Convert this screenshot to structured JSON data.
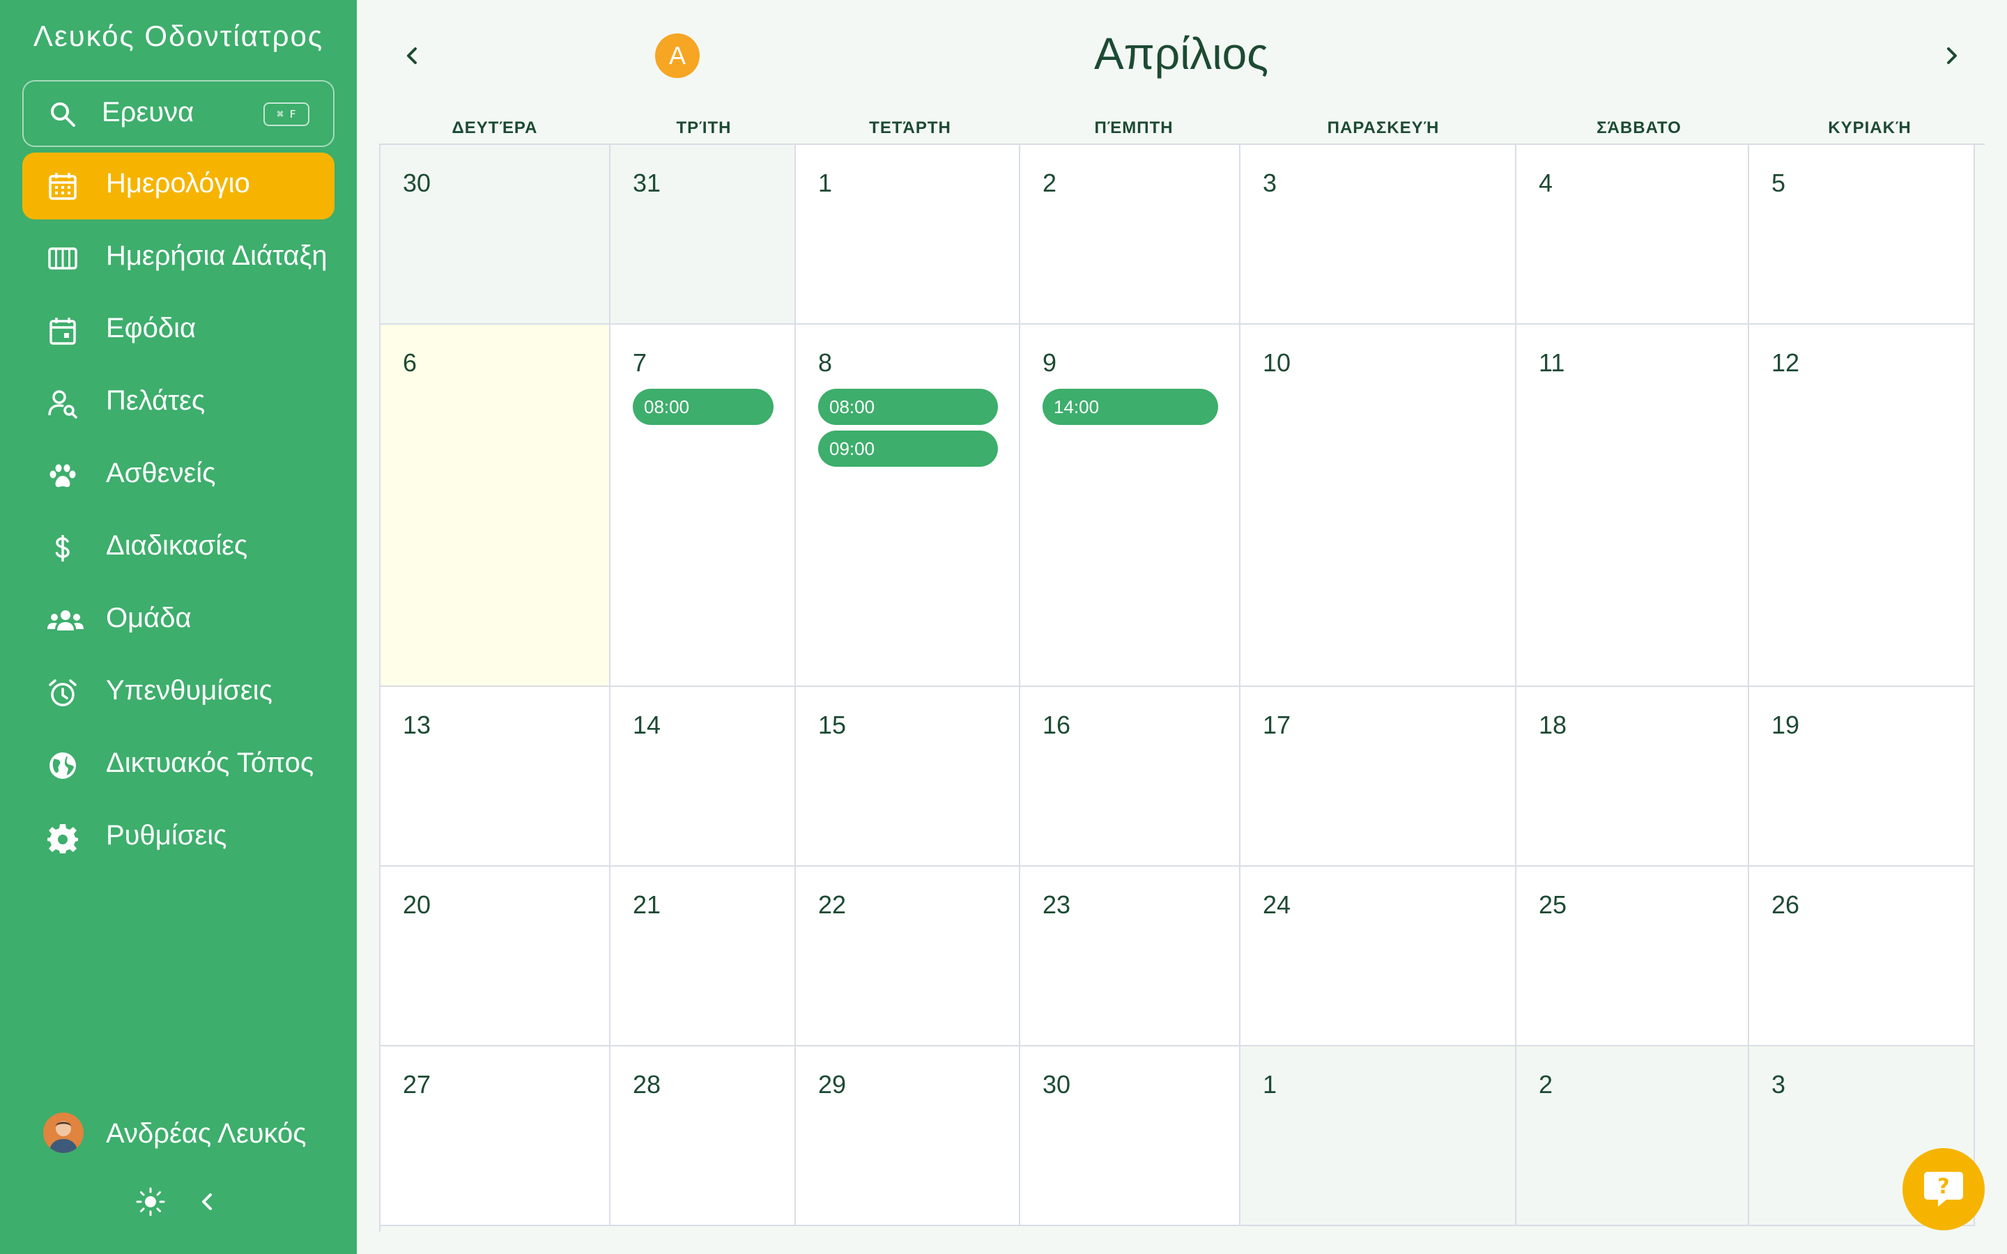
{
  "sidebar": {
    "brand": "Λευκός Οδοντίατρος",
    "search": {
      "label": "Ερευνα",
      "shortcut": "⌘ F"
    },
    "items": [
      {
        "label": "Ημερολόγιο",
        "icon": "calendar-icon",
        "active": true
      },
      {
        "label": "Ημερήσια Διάταξη",
        "icon": "columns-icon",
        "active": false
      },
      {
        "label": "Εφόδια",
        "icon": "calendar-day-icon",
        "active": false
      },
      {
        "label": "Πελάτες",
        "icon": "user-search-icon",
        "active": false
      },
      {
        "label": "Ασθενείς",
        "icon": "paw-icon",
        "active": false
      },
      {
        "label": "Διαδικασίες",
        "icon": "dollar-icon",
        "active": false
      },
      {
        "label": "Ομάδα",
        "icon": "users-icon",
        "active": false
      },
      {
        "label": "Υπενθυμίσεις",
        "icon": "alarm-clock-icon",
        "active": false
      },
      {
        "label": "Δικτυακός Τόπος",
        "icon": "globe-icon",
        "active": false
      },
      {
        "label": "Ρυθμίσεις",
        "icon": "gear-icon",
        "active": false
      }
    ],
    "user": {
      "name": "Ανδρέας Λευκός"
    }
  },
  "header": {
    "month": "Απρίλιος",
    "avatar_letter": "A"
  },
  "calendar": {
    "weekdays": [
      "ΔΕΥΤΈΡΑ",
      "ΤΡΊΤΗ",
      "ΤΕΤΆΡΤΗ",
      "ΠΈΜΠΤΗ",
      "ΠΑΡΑΣΚΕΥΉ",
      "ΣΆΒΒΑΤΟ",
      "ΚΥΡΙΑΚΉ"
    ],
    "weeks": [
      {
        "days": [
          {
            "num": "30",
            "other": true
          },
          {
            "num": "31",
            "other": true
          },
          {
            "num": "1"
          },
          {
            "num": "2"
          },
          {
            "num": "3"
          },
          {
            "num": "4"
          },
          {
            "num": "5"
          }
        ]
      },
      {
        "days": [
          {
            "num": "6",
            "today": true
          },
          {
            "num": "7",
            "events": [
              "08:00"
            ]
          },
          {
            "num": "8",
            "events": [
              "08:00",
              "09:00"
            ]
          },
          {
            "num": "9",
            "events": [
              "14:00"
            ]
          },
          {
            "num": "10"
          },
          {
            "num": "11"
          },
          {
            "num": "12"
          }
        ]
      },
      {
        "days": [
          {
            "num": "13"
          },
          {
            "num": "14"
          },
          {
            "num": "15"
          },
          {
            "num": "16"
          },
          {
            "num": "17"
          },
          {
            "num": "18"
          },
          {
            "num": "19"
          }
        ]
      },
      {
        "days": [
          {
            "num": "20"
          },
          {
            "num": "21"
          },
          {
            "num": "22"
          },
          {
            "num": "23"
          },
          {
            "num": "24"
          },
          {
            "num": "25"
          },
          {
            "num": "26"
          }
        ]
      },
      {
        "days": [
          {
            "num": "27"
          },
          {
            "num": "28"
          },
          {
            "num": "29"
          },
          {
            "num": "30"
          },
          {
            "num": "1",
            "other": true
          },
          {
            "num": "2",
            "other": true
          },
          {
            "num": "3",
            "other": true
          }
        ]
      }
    ]
  },
  "colors": {
    "sidebar": "#3dae6c",
    "accent": "#f6b400",
    "event": "#3dae6c",
    "text": "#1d4a33"
  }
}
